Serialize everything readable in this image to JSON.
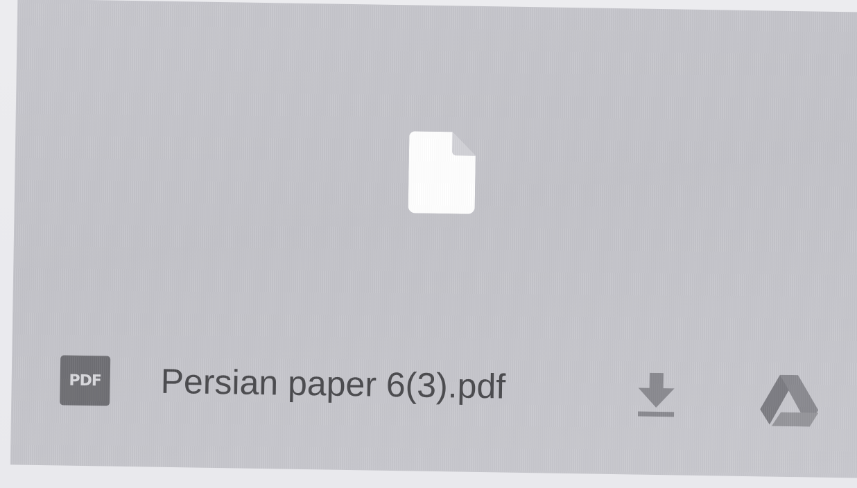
{
  "attachment": {
    "file_type_badge": "PDF",
    "file_name": "Persian paper 6(3).pdf",
    "preview_icon": "file-icon",
    "actions": [
      {
        "name": "download",
        "icon": "download-icon"
      },
      {
        "name": "save-to-drive",
        "icon": "google-drive-icon"
      }
    ]
  },
  "colors": {
    "card_background": "#c5c5cb",
    "page_background": "#ececef",
    "icon_gray": "#8a8a90",
    "text": "#4a4a4e",
    "badge": "#6f6f74"
  }
}
